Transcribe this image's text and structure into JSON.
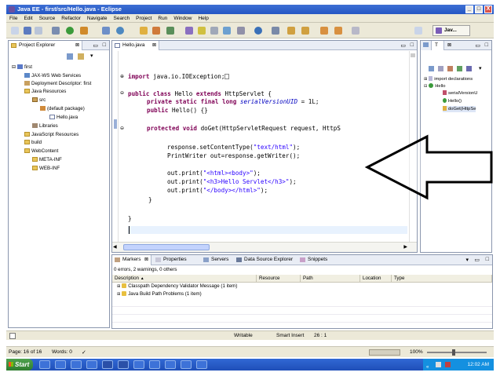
{
  "window": {
    "title": "Java EE - first/src/Hello.java - Eclipse",
    "btn_min": "_",
    "btn_max": "□",
    "btn_close": "X"
  },
  "menu": [
    "File",
    "Edit",
    "Source",
    "Refactor",
    "Navigate",
    "Search",
    "Project",
    "Run",
    "Window",
    "Help"
  ],
  "toolbar": {
    "perspective_label": "Jav..."
  },
  "project_explorer": {
    "tab_label": "Project Explorer",
    "items": [
      {
        "label": "first"
      },
      {
        "label": "JAX-WS Web Services"
      },
      {
        "label": "Deployment Descriptor: first"
      },
      {
        "label": "Java Resources"
      },
      {
        "label": "src"
      },
      {
        "label": "(default package)"
      },
      {
        "label": "Hello.java"
      },
      {
        "label": "Libraries"
      },
      {
        "label": "JavaScript Resources"
      },
      {
        "label": "build"
      },
      {
        "label": "WebContent"
      },
      {
        "label": "META-INF"
      },
      {
        "label": "WEB-INF"
      }
    ]
  },
  "editor": {
    "tab_label": "Hello.java",
    "code": {
      "import_kw": "import",
      "import_rest": " java.io.IOException;",
      "l2_kw": "public class",
      "l2_mid": " Hello ",
      "l2_kw2": "extends",
      "l2_rest": " HttpServlet {",
      "l3_kw": "private static final long",
      "l3_ital": "serialVersionUID",
      "l3_rest": " = 1L;",
      "l4_kw": "public",
      "l4_rest": " Hello() {}",
      "l5_kw": "protected void",
      "l5_rest": " doGet(HttpServletRequest request, HttpS",
      "l6_a": "response.setContentType(",
      "l6_str": "\"text/html\"",
      "l6_b": ");",
      "l7": "PrintWriter out=response.getWriter();",
      "l8_a": "out.print(",
      "l8_str": "\"<html><body>\"",
      "l8_b": ");",
      "l9_a": "out.print(",
      "l9_str": "\"<h3>Hello Servlet</h3>\"",
      "l9_b": ");",
      "l10_a": "out.print(",
      "l10_str": "\"</body></html>\"",
      "l10_b": ");",
      "l11": "}",
      "l12": "}"
    }
  },
  "outline": {
    "tab_label": "T",
    "items": [
      {
        "label": "import declarations"
      },
      {
        "label": "Hello"
      },
      {
        "label": "serialVersionU"
      },
      {
        "label": "Hello()"
      },
      {
        "label": "doGet(HttpSe"
      }
    ]
  },
  "bottom_panel": {
    "tabs": [
      "Markers",
      "Properties",
      "Servers",
      "Data Source Explorer",
      "Snippets"
    ],
    "summary": "0 errors, 2 warnings, 0 others",
    "columns": [
      "Description",
      "Resource",
      "Path",
      "Location",
      "Type"
    ],
    "rows": [
      {
        "description": "Classpath Dependency Validator Message (1 item)"
      },
      {
        "description": "Java Build Path Problems (1 item)"
      }
    ]
  },
  "status": {
    "writable": "Writable",
    "insert_mode": "Smart Insert",
    "position": "26 : 1"
  },
  "lower_status": {
    "page": "Page: 16 of 16",
    "words": "Words: 0",
    "zoom": "100%"
  },
  "taskbar": {
    "start_label": "Start",
    "clock": "12:02 AM"
  },
  "colors": {
    "arrow": "#000000",
    "keyword": "#7f0055",
    "string": "#2a00ff",
    "titlebar": "#2456c4"
  }
}
